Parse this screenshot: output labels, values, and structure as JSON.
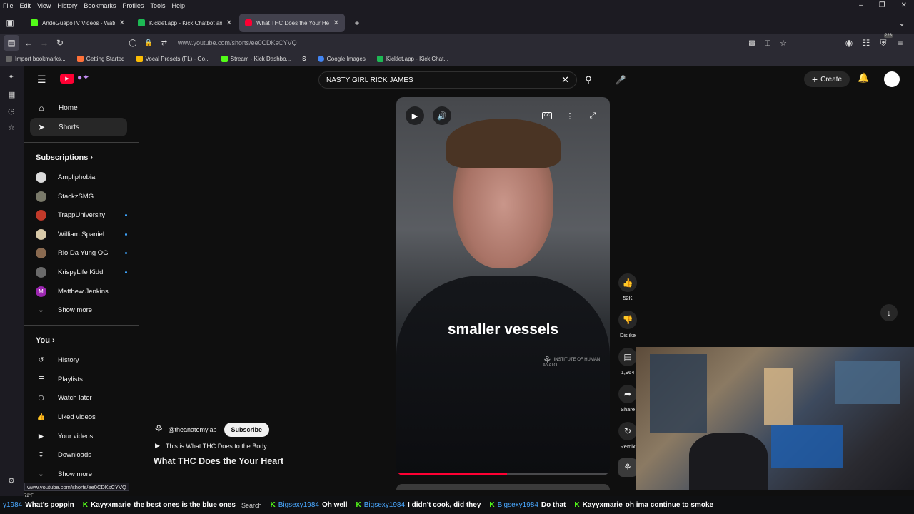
{
  "menubar": {
    "items": [
      "File",
      "Edit",
      "View",
      "History",
      "Bookmarks",
      "Profiles",
      "Tools",
      "Help"
    ]
  },
  "tabs": [
    {
      "label": "AndeGuapoTV Videos - Watch (",
      "color": "#53fc18"
    },
    {
      "label": "Kicklet.app - Kick Chatbot and C",
      "color": "#1db954"
    },
    {
      "label": "What THC Does the Your Heart",
      "color": "#ff0033",
      "active": true
    }
  ],
  "address": {
    "url": "www.youtube.com/shorts/ee0CDKsCYVQ",
    "badge": "223"
  },
  "bookmarks": [
    {
      "label": "Import bookmarks..."
    },
    {
      "label": "Getting Started"
    },
    {
      "label": "Vocal Presets (FL) - Go..."
    },
    {
      "label": "Stream - Kick Dashbo..."
    },
    {
      "label": "S"
    },
    {
      "label": "Google Images"
    },
    {
      "label": "Kicklet.app - Kick Chat..."
    }
  ],
  "search": {
    "query": "NASTY GIRL RICK JAMES"
  },
  "header": {
    "create": "Create"
  },
  "nav": {
    "home": "Home",
    "shorts": "Shorts"
  },
  "subscriptions": {
    "title": "Subscriptions",
    "items": [
      {
        "name": "Ampliphobia",
        "color": "#dcdcdc",
        "dot": false
      },
      {
        "name": "StackzSMG",
        "color": "#7a7a6a",
        "dot": false
      },
      {
        "name": "TrappUniversity",
        "color": "#c23a2a",
        "dot": true
      },
      {
        "name": "William Spaniel",
        "color": "#d8c9a8",
        "dot": true
      },
      {
        "name": "Rio Da Yung OG",
        "color": "#8a6a50",
        "dot": true
      },
      {
        "name": "KrispyLife Kidd",
        "color": "#6a6a6a",
        "dot": true
      },
      {
        "name": "Matthew Jenkins",
        "color": "#9c27b0",
        "dot": false,
        "letter": "M"
      }
    ],
    "show_more": "Show more"
  },
  "you": {
    "title": "You",
    "items": [
      "History",
      "Playlists",
      "Watch later",
      "Liked videos",
      "Your videos",
      "Downloads"
    ],
    "show_more": "Show more"
  },
  "video": {
    "caption": "smaller vessels",
    "watermark": "INSTITUTE OF HUMAN ANATO",
    "progress": 0.52
  },
  "actions": {
    "likes": "52K",
    "dislike": "Dislike",
    "comments": "1,964",
    "share": "Share",
    "remix": "Remix"
  },
  "channel": {
    "handle": "@theanatomylab",
    "subscribe": "Subscribe",
    "music": "This is What THC Does to the Body",
    "title": "What THC Does the Your Heart"
  },
  "status_url": "www.youtube.com/shorts/ee0CDKsCYVQ",
  "ticker": [
    {
      "user": "y1984",
      "msg": "What's poppin"
    },
    {
      "user": "Kayyxmarie",
      "msg": "the best ones is the blue ones"
    },
    {
      "user": "Bigsexy1984",
      "msg": "Oh well"
    },
    {
      "user": "Bigsexy1984",
      "msg": "I didn't cook, did they"
    },
    {
      "user": "Bigsexy1984",
      "msg": "Do that"
    },
    {
      "user": "Kayyxmarie",
      "msg": "oh ima continue to smoke"
    }
  ],
  "taskbar": {
    "weather": "72°F",
    "search": "Search"
  }
}
